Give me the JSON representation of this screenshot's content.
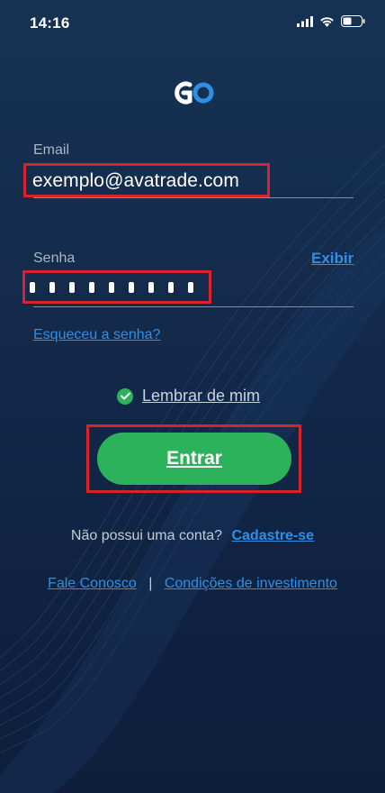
{
  "status_bar": {
    "time": "14:16"
  },
  "form": {
    "email_label": "Email",
    "email_value": "exemplo@avatrade.com",
    "password_label": "Senha",
    "show_password_label": "Exibir",
    "password_masked_count": 9,
    "forgot_password": "Esqueceu a senha?",
    "remember_me": "Lembrar de mim",
    "remember_me_checked": true,
    "submit_label": "Entrar"
  },
  "signup": {
    "question": "Não possui uma conta?",
    "link": "Cadastre-se"
  },
  "footer": {
    "contact": "Fale Conosco",
    "separator": "|",
    "conditions": "Condições de investimento"
  },
  "colors": {
    "accent_green": "#2bb25a",
    "link_blue": "#2f8fe6",
    "highlight_red": "#d8232a",
    "background": "#13294a"
  },
  "icons": [
    "signal-icon",
    "wifi-icon",
    "battery-icon",
    "logo-icon",
    "check-icon"
  ]
}
